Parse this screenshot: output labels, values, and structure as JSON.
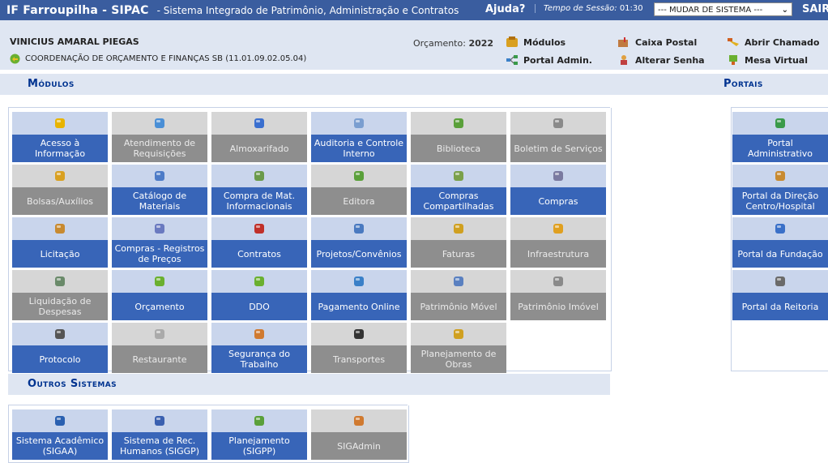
{
  "topbar": {
    "brand": "IF Farroupilha - SIPAC",
    "subtitle": "- Sistema Integrado de Patrimônio, Administração e Contratos",
    "help": "Ajuda?",
    "session_label": "Tempo de Sessão:",
    "session_value": "01:30",
    "system_select": "--- MUDAR DE SISTEMA ---",
    "logout": "SAIR"
  },
  "user": {
    "name": "VINICIUS AMARAL PIEGAS",
    "unit": "COORDENAÇÃO DE ORÇAMENTO E FINANÇAS SB (11.01.09.02.05.04)",
    "budget_label": "Orçamento:",
    "budget_year": "2022"
  },
  "quick_links": [
    {
      "label": "Módulos",
      "icon": "modules-icon"
    },
    {
      "label": "Caixa Postal",
      "icon": "mailbox-icon"
    },
    {
      "label": "Abrir Chamado",
      "icon": "ticket-icon"
    },
    {
      "label": "Portal Admin.",
      "icon": "portal-admin-icon"
    },
    {
      "label": "Alterar Senha",
      "icon": "password-icon"
    },
    {
      "label": "Mesa Virtual",
      "icon": "virtual-desk-icon"
    }
  ],
  "sections": {
    "modules": "Módulos",
    "portals": "Portais",
    "other": "Outros Sistemas"
  },
  "modules": [
    {
      "label": "Acesso à Informação",
      "active": true,
      "icon": "info-icon",
      "color": "#e8b400"
    },
    {
      "label": "Atendimento de Requisições",
      "active": false,
      "icon": "document-check-icon",
      "color": "#4a8fd6"
    },
    {
      "label": "Almoxarifado",
      "active": false,
      "icon": "boxes-icon",
      "color": "#3a6fcf"
    },
    {
      "label": "Auditoria e Controle Interno",
      "active": true,
      "icon": "auditor-icon",
      "color": "#7a9ed0"
    },
    {
      "label": "Biblioteca",
      "active": false,
      "icon": "books-icon",
      "color": "#5aa03a"
    },
    {
      "label": "Boletim de Serviços",
      "active": false,
      "icon": "bulletin-icon",
      "color": "#8a8a8a"
    },
    {
      "label": "Bolsas/Auxílios",
      "active": false,
      "icon": "wallet-icon",
      "color": "#d9a020"
    },
    {
      "label": "Catálogo de Materiais",
      "active": true,
      "icon": "catalog-icon",
      "color": "#4d7bc7"
    },
    {
      "label": "Compra de Mat. Informacionais",
      "active": true,
      "icon": "computer-purchase-icon",
      "color": "#6a9a4a"
    },
    {
      "label": "Editora",
      "active": false,
      "icon": "publisher-icon",
      "color": "#5aa03a"
    },
    {
      "label": "Compras Compartilhadas",
      "active": true,
      "icon": "shared-cart-icon",
      "color": "#7aa04a"
    },
    {
      "label": "Compras",
      "active": true,
      "icon": "cart-icon",
      "color": "#7a7aa0"
    },
    {
      "label": "Licitação",
      "active": true,
      "icon": "bidding-people-icon",
      "color": "#c88a30"
    },
    {
      "label": "Compras - Registros de Preços",
      "active": true,
      "icon": "price-registry-icon",
      "color": "#6a7ac0"
    },
    {
      "label": "Contratos",
      "active": true,
      "icon": "contract-pen-icon",
      "color": "#c0302a"
    },
    {
      "label": "Projetos/Convênios",
      "active": true,
      "icon": "projects-icon",
      "color": "#4a7ac0"
    },
    {
      "label": "Faturas",
      "active": false,
      "icon": "invoice-icon",
      "color": "#d0a020"
    },
    {
      "label": "Infraestrutura",
      "active": false,
      "icon": "worker-icon",
      "color": "#e0a020"
    },
    {
      "label": "Liquidação de Despesas",
      "active": false,
      "icon": "cart-money-icon",
      "color": "#6a8a6a"
    },
    {
      "label": "Orçamento",
      "active": true,
      "icon": "budget-icon",
      "color": "#6ab030"
    },
    {
      "label": "DDO",
      "active": true,
      "icon": "ddo-icon",
      "color": "#6ab030"
    },
    {
      "label": "Pagamento Online",
      "active": true,
      "icon": "online-payment-icon",
      "color": "#3a80c8"
    },
    {
      "label": "Patrimônio Móvel",
      "active": false,
      "icon": "movable-assets-icon",
      "color": "#5a80c0"
    },
    {
      "label": "Patrimônio Imóvel",
      "active": false,
      "icon": "building-icon",
      "color": "#8a8a8a"
    },
    {
      "label": "Protocolo",
      "active": true,
      "icon": "protocol-book-icon",
      "color": "#555555"
    },
    {
      "label": "Restaurante",
      "active": false,
      "icon": "cup-icon",
      "color": "#aaaaaa"
    },
    {
      "label": "Segurança do Trabalho",
      "active": true,
      "icon": "safety-worker-icon",
      "color": "#d07a30"
    },
    {
      "label": "Transportes",
      "active": false,
      "icon": "wheel-icon",
      "color": "#333333"
    },
    {
      "label": "Planejamento de Obras",
      "active": false,
      "icon": "construction-plan-icon",
      "color": "#d0a020"
    }
  ],
  "portals": [
    {
      "label": "Portal Administrativo",
      "icon": "admin-network-icon",
      "color": "#3a9a4a"
    },
    {
      "label": "Portal da Direção Centro/Hospital",
      "icon": "directors-icon",
      "color": "#c88a30"
    },
    {
      "label": "Portal da Fundação",
      "icon": "globe-icon",
      "color": "#3a70c8"
    },
    {
      "label": "Portal da Reitoria",
      "icon": "rector-icon",
      "color": "#6a6a6a"
    }
  ],
  "other_systems": [
    {
      "label": "Sistema Acadêmico (SIGAA)",
      "active": true,
      "icon": "academic-book-icon",
      "color": "#2a60b0"
    },
    {
      "label": "Sistema de Rec. Humanos (SIGGP)",
      "active": true,
      "icon": "person-icon",
      "color": "#3a60b0"
    },
    {
      "label": "Planejamento (SIGPP)",
      "active": true,
      "icon": "planning-chart-icon",
      "color": "#5aa03a"
    },
    {
      "label": "SIGAdmin",
      "active": false,
      "icon": "admin-user-icon",
      "color": "#d07a30"
    }
  ]
}
